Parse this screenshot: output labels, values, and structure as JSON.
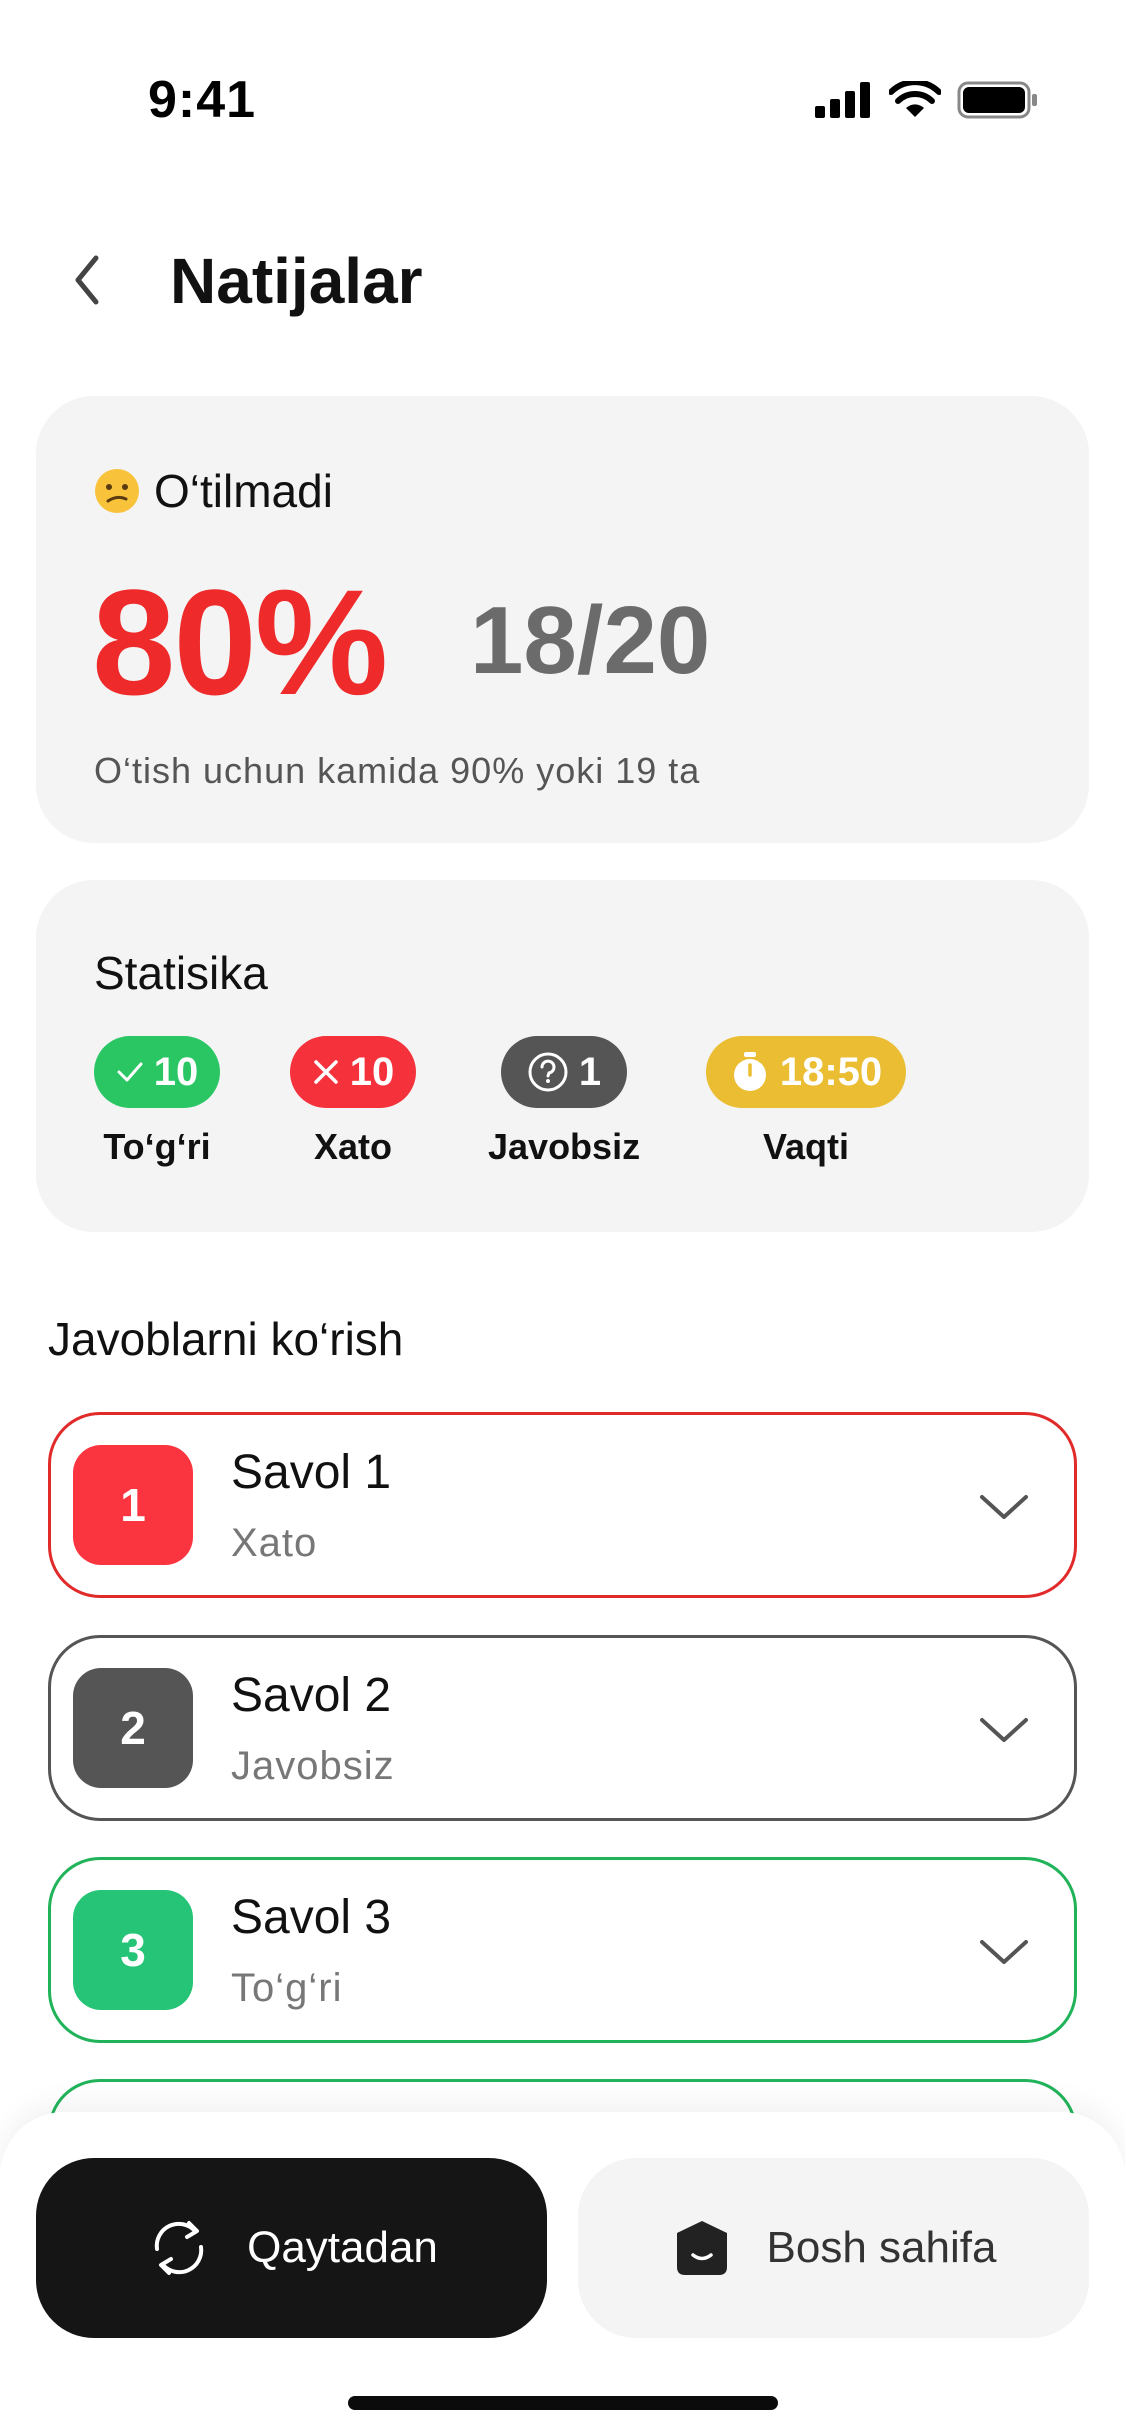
{
  "status_bar": {
    "time": "9:41",
    "icons": [
      "signal-icon",
      "wifi-icon",
      "battery-icon"
    ]
  },
  "header": {
    "title": "Natijalar",
    "back_icon": "chevron-left-icon"
  },
  "result": {
    "status_text": "O‘tilmadi",
    "status_icon": "sad-face-emoji",
    "percent": "80%",
    "score": "18/20",
    "pass_note": "O‘tish uchun kamida 90% yoki 19 ta"
  },
  "stats": {
    "title": "Statisika",
    "items": [
      {
        "icon": "check-icon",
        "value": "10",
        "label": "To‘g‘ri",
        "color": "#2ac664"
      },
      {
        "icon": "x-icon",
        "value": "10",
        "label": "Xato",
        "color": "#f5323c"
      },
      {
        "icon": "question-icon",
        "value": "1",
        "label": "Javobsiz",
        "color": "#555555"
      },
      {
        "icon": "timer-icon",
        "value": "18:50",
        "label": "Vaqti",
        "color": "#ebbd33"
      }
    ]
  },
  "answers": {
    "title": "Javoblarni ko‘rish",
    "items": [
      {
        "number": "1",
        "title": "Savol 1",
        "status": "Xato",
        "color": "#e12b2b"
      },
      {
        "number": "2",
        "title": "Savol 2",
        "status": "Javobsiz",
        "color": "#555555"
      },
      {
        "number": "3",
        "title": "Savol 3",
        "status": "To‘g‘ri",
        "color": "#21b35a"
      }
    ]
  },
  "actions": {
    "retry_label": "Qaytadan",
    "retry_icon": "refresh-icon",
    "home_label": "Bosh sahifa",
    "home_icon": "home-icon"
  }
}
